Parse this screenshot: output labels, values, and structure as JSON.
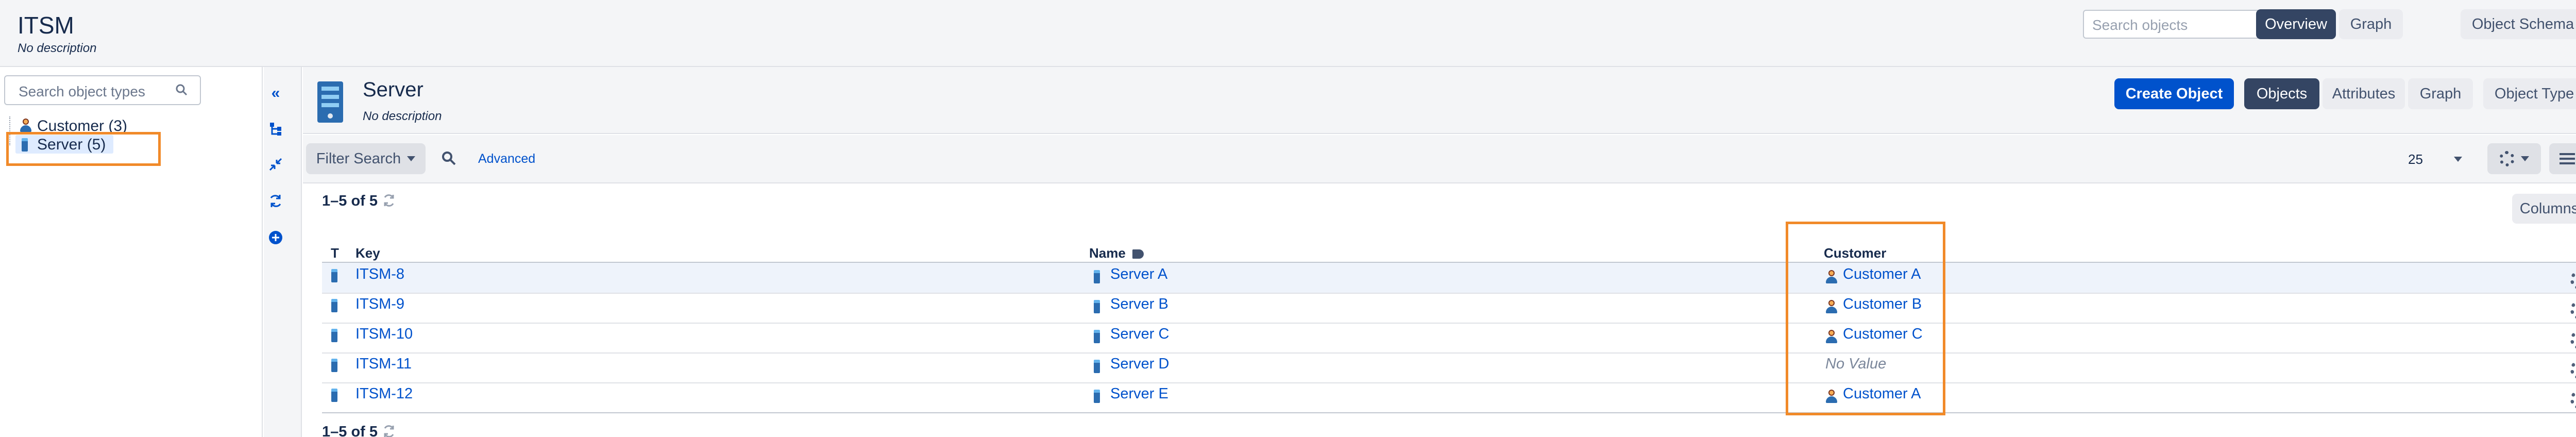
{
  "header": {
    "title": "ITSM",
    "description": "No description",
    "search_placeholder": "Search objects",
    "tabs": [
      "Overview",
      "Graph",
      "Object Schema"
    ]
  },
  "sidebar": {
    "search_placeholder": "Search object types",
    "items": [
      {
        "label": "Customer (3)",
        "icon": "person-icon"
      },
      {
        "label": "Server (5)",
        "icon": "server-icon"
      }
    ]
  },
  "object_type": {
    "name": "Server",
    "description": "No description",
    "create_button": "Create Object",
    "tabs": [
      "Objects",
      "Attributes",
      "Graph",
      "Object Type"
    ]
  },
  "filter_bar": {
    "filter_label": "Filter Search",
    "advanced_label": "Advanced",
    "page_size": "25"
  },
  "results": {
    "count_label": "1–5 of 5",
    "columns_button": "Columns",
    "headers": {
      "type": "T",
      "key": "Key",
      "name": "Name",
      "customer": "Customer"
    },
    "rows": [
      {
        "key": "ITSM-8",
        "name": "Server A",
        "customer": "Customer A"
      },
      {
        "key": "ITSM-9",
        "name": "Server B",
        "customer": "Customer B"
      },
      {
        "key": "ITSM-10",
        "name": "Server C",
        "customer": "Customer C"
      },
      {
        "key": "ITSM-11",
        "name": "Server D",
        "customer": "No Value"
      },
      {
        "key": "ITSM-12",
        "name": "Server E",
        "customer": "Customer A"
      }
    ],
    "footer_count": "1–5 of 5"
  },
  "colors": {
    "primary": "#0052cc",
    "dark_button": "#344563",
    "highlight": "#f18a29",
    "header_bg": "#f4f5f7"
  }
}
